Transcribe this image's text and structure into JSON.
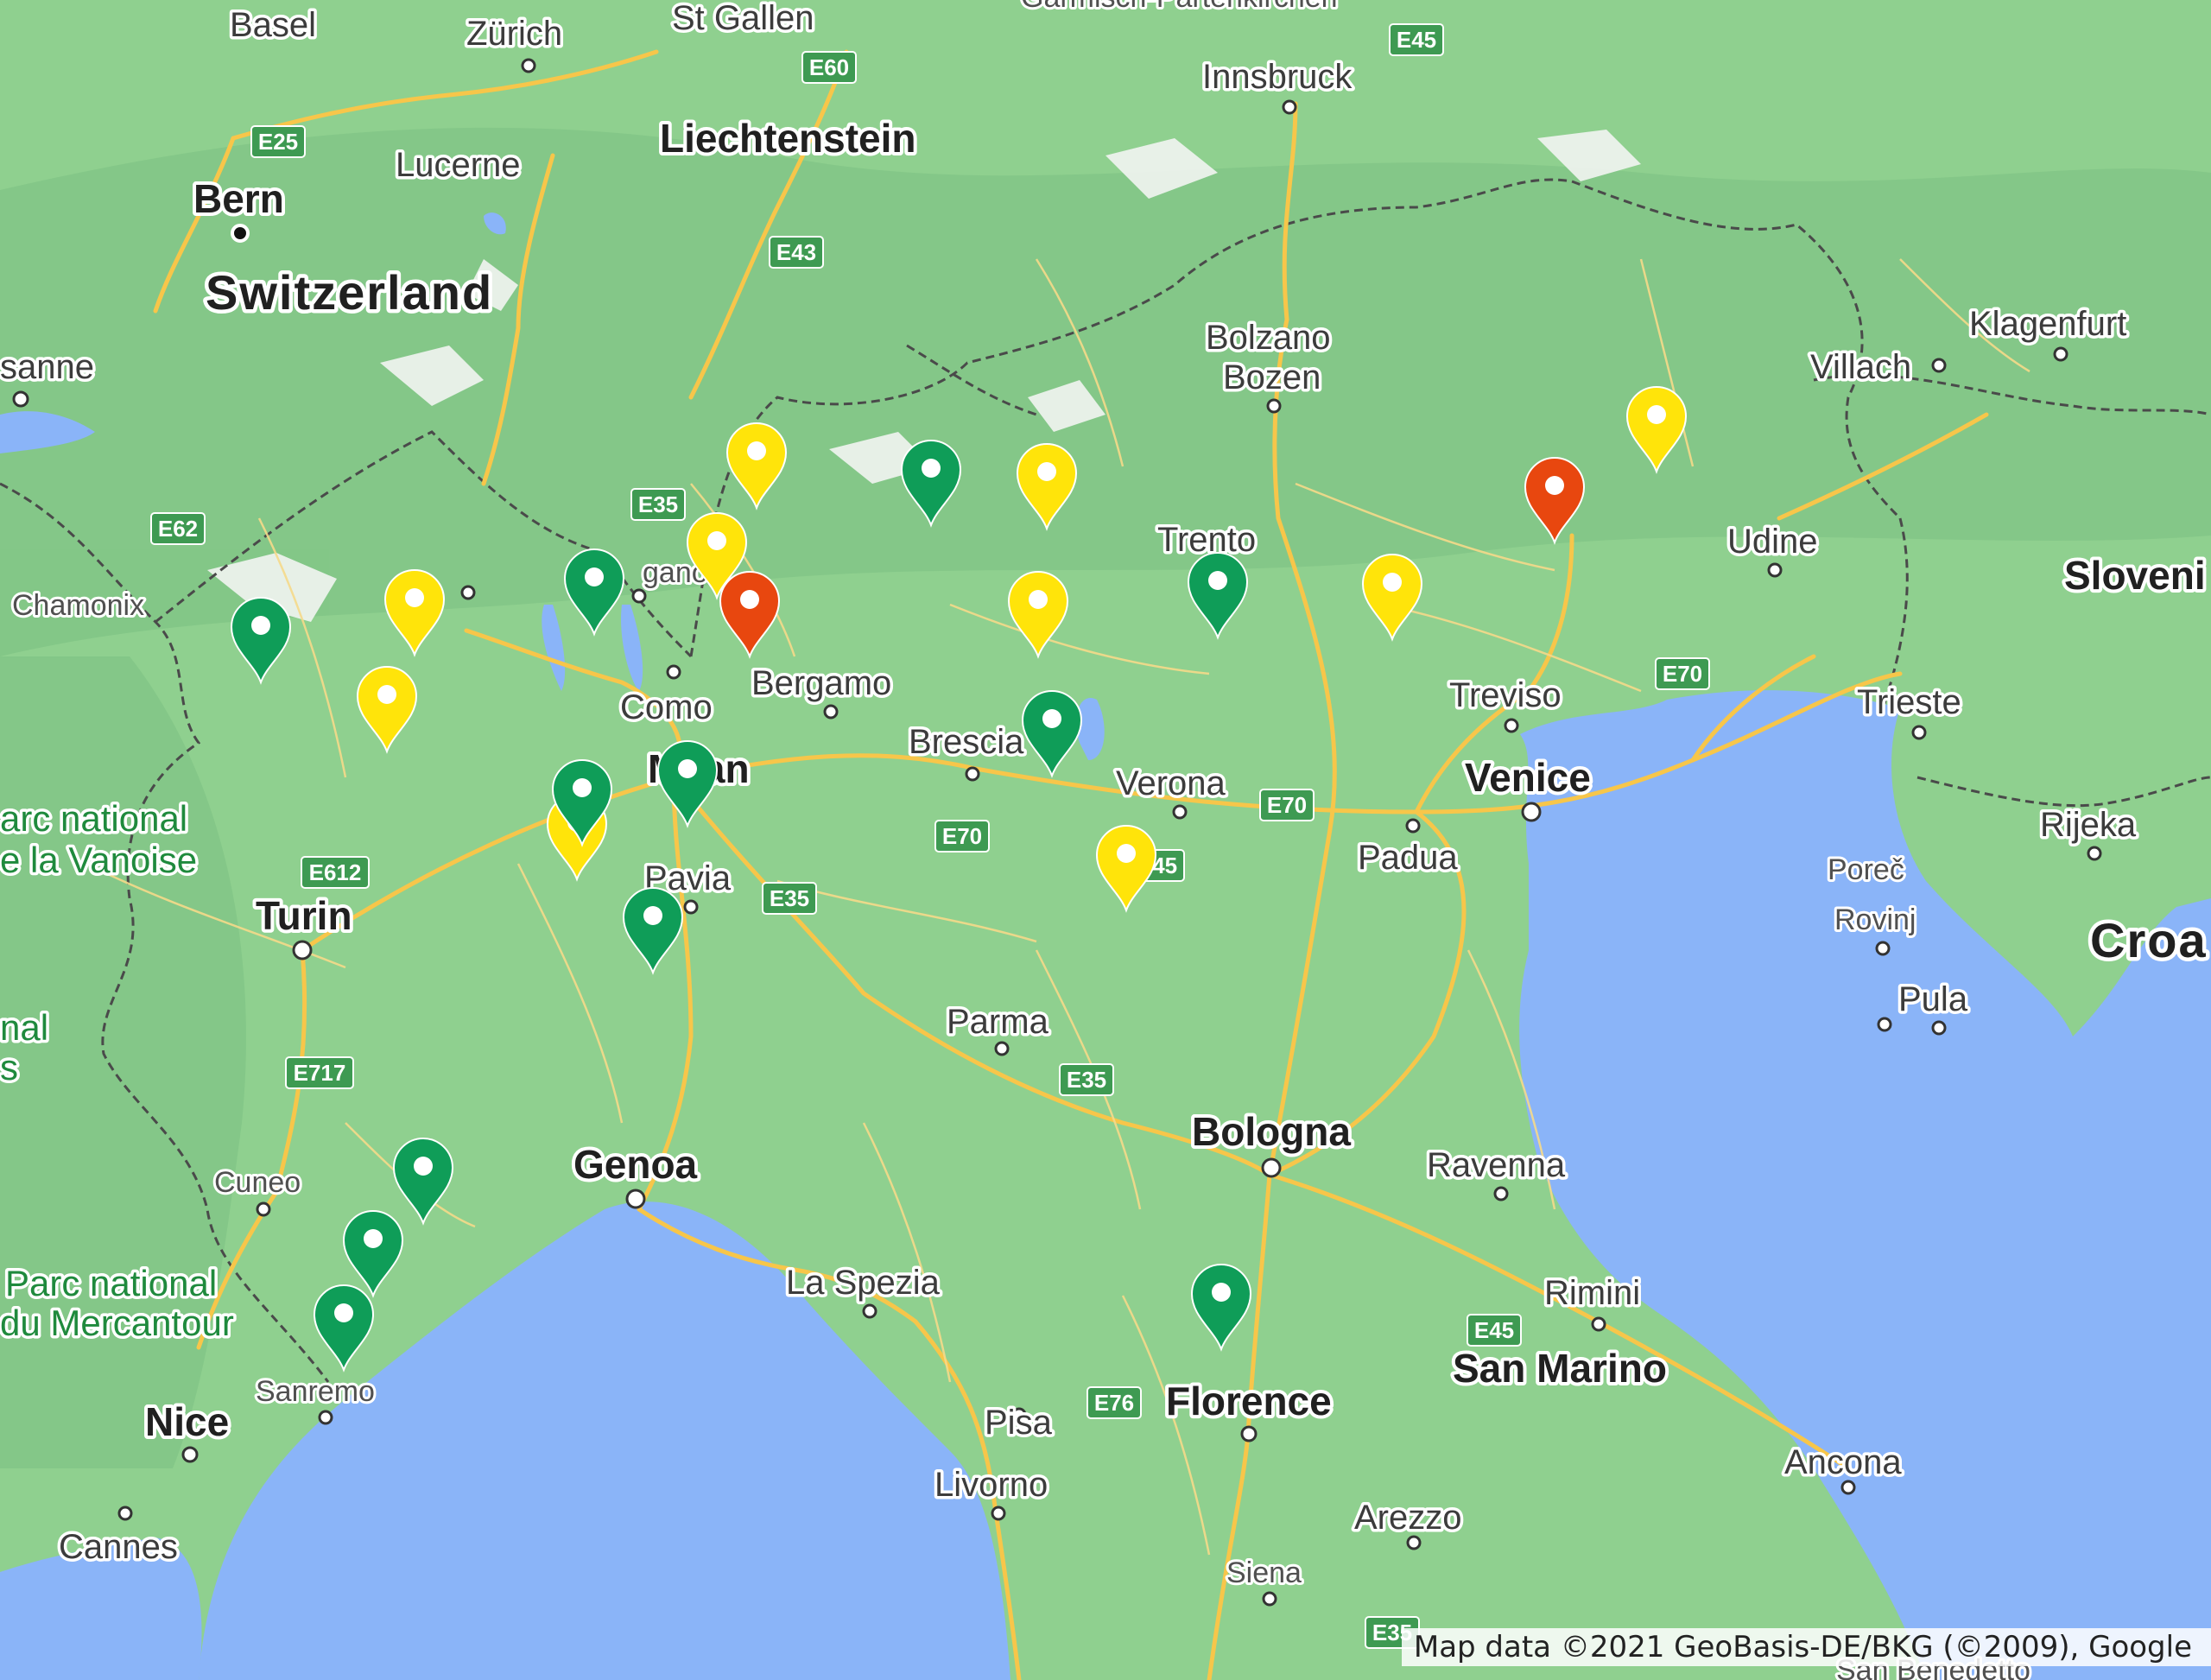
{
  "map": {
    "colors": {
      "land": "#8fd08f",
      "water": "#8ab4f8",
      "road": "#f7c64a",
      "border": "#4a4a4a"
    },
    "countries": [
      {
        "id": "switzerland",
        "name": "Switzerland"
      },
      {
        "id": "liechtenstein",
        "name": "Liechtenstein"
      },
      {
        "id": "slovenia",
        "name": "Sloveni"
      },
      {
        "id": "croatia",
        "name": "Croa"
      },
      {
        "id": "san-marino",
        "name": "San Marino"
      }
    ],
    "cities": [
      {
        "id": "basel",
        "name": "Basel"
      },
      {
        "id": "zurich",
        "name": "Zürich"
      },
      {
        "id": "st-gallen",
        "name": "St Gallen"
      },
      {
        "id": "garmisch",
        "name": "Garmisch-Partenkirchen"
      },
      {
        "id": "innsbruck",
        "name": "Innsbruck"
      },
      {
        "id": "lucerne",
        "name": "Lucerne"
      },
      {
        "id": "bern",
        "name": "Bern"
      },
      {
        "id": "lausanne",
        "name": "sanne"
      },
      {
        "id": "chamonix",
        "name": "Chamonix"
      },
      {
        "id": "lugano",
        "name": "gano"
      },
      {
        "id": "como",
        "name": "Como"
      },
      {
        "id": "bergamo",
        "name": "Bergamo"
      },
      {
        "id": "brescia",
        "name": "Brescia"
      },
      {
        "id": "milan",
        "name": "Milan"
      },
      {
        "id": "pavia",
        "name": "Pavia"
      },
      {
        "id": "turin",
        "name": "Turin"
      },
      {
        "id": "verona",
        "name": "Verona"
      },
      {
        "id": "trento",
        "name": "Trento"
      },
      {
        "id": "bolzano",
        "name": "Bolzano"
      },
      {
        "id": "bozen",
        "name": "Bozen"
      },
      {
        "id": "treviso",
        "name": "Treviso"
      },
      {
        "id": "venice",
        "name": "Venice"
      },
      {
        "id": "padua",
        "name": "Padua"
      },
      {
        "id": "udine",
        "name": "Udine"
      },
      {
        "id": "villach",
        "name": "Villach"
      },
      {
        "id": "klagenfurt",
        "name": "Klagenfurt"
      },
      {
        "id": "trieste",
        "name": "Trieste"
      },
      {
        "id": "rijeka",
        "name": "Rijeka"
      },
      {
        "id": "porec",
        "name": "Poreč"
      },
      {
        "id": "rovinj",
        "name": "Rovinj"
      },
      {
        "id": "pula",
        "name": "Pula"
      },
      {
        "id": "parma",
        "name": "Parma"
      },
      {
        "id": "bologna",
        "name": "Bologna"
      },
      {
        "id": "ravenna",
        "name": "Ravenna"
      },
      {
        "id": "rimini",
        "name": "Rimini"
      },
      {
        "id": "genoa",
        "name": "Genoa"
      },
      {
        "id": "cuneo",
        "name": "Cuneo"
      },
      {
        "id": "la-spezia",
        "name": "La Spezia"
      },
      {
        "id": "sanremo",
        "name": "Sanremo"
      },
      {
        "id": "nice",
        "name": "Nice"
      },
      {
        "id": "cannes",
        "name": "Cannes"
      },
      {
        "id": "pisa",
        "name": "Pisa"
      },
      {
        "id": "livorno",
        "name": "Livorno"
      },
      {
        "id": "florence",
        "name": "Florence"
      },
      {
        "id": "arezzo",
        "name": "Arezzo"
      },
      {
        "id": "siena",
        "name": "Siena"
      },
      {
        "id": "ancona",
        "name": "Ancona"
      },
      {
        "id": "san-benedetto",
        "name": "San Benedetto"
      }
    ],
    "parks": [
      {
        "id": "vanoise-1",
        "name": "arc national"
      },
      {
        "id": "vanoise-2",
        "name": "e la Vanoise"
      },
      {
        "id": "mercantour-1",
        "name": "Parc national"
      },
      {
        "id": "mercantour-2",
        "name": "du Mercantour"
      },
      {
        "id": "ecrins-1",
        "name": "nal"
      },
      {
        "id": "ecrins-2",
        "name": "s"
      }
    ],
    "highways": [
      {
        "id": "e45-north",
        "name": "E45"
      },
      {
        "id": "e60",
        "name": "E60"
      },
      {
        "id": "e25",
        "name": "E25"
      },
      {
        "id": "e43",
        "name": "E43"
      },
      {
        "id": "e35-north",
        "name": "E35"
      },
      {
        "id": "e62",
        "name": "E62"
      },
      {
        "id": "e612",
        "name": "E612"
      },
      {
        "id": "e35-pavia",
        "name": "E35"
      },
      {
        "id": "e70-brescia",
        "name": "E70"
      },
      {
        "id": "e45-verona",
        "name": "E45"
      },
      {
        "id": "e70-verona",
        "name": "E70"
      },
      {
        "id": "e70-venice",
        "name": "E70"
      },
      {
        "id": "e717",
        "name": "E717"
      },
      {
        "id": "e35-bologna",
        "name": "E35"
      },
      {
        "id": "e45-rimini",
        "name": "E45"
      },
      {
        "id": "e76",
        "name": "E76"
      },
      {
        "id": "e35-south",
        "name": "E35"
      }
    ],
    "markers": [
      {
        "id": "marker-1",
        "color": "yellow"
      },
      {
        "id": "marker-2",
        "color": "green"
      },
      {
        "id": "marker-3",
        "color": "yellow"
      },
      {
        "id": "marker-4",
        "color": "yellow"
      },
      {
        "id": "marker-5",
        "color": "red"
      },
      {
        "id": "marker-6",
        "color": "yellow"
      },
      {
        "id": "marker-7",
        "color": "green"
      },
      {
        "id": "marker-8",
        "color": "yellow"
      },
      {
        "id": "marker-9",
        "color": "green"
      },
      {
        "id": "marker-10",
        "color": "yellow"
      },
      {
        "id": "marker-11",
        "color": "red"
      },
      {
        "id": "marker-12",
        "color": "yellow"
      },
      {
        "id": "marker-13",
        "color": "green"
      },
      {
        "id": "marker-14",
        "color": "yellow"
      },
      {
        "id": "marker-15",
        "color": "green"
      },
      {
        "id": "marker-16",
        "color": "yellow"
      },
      {
        "id": "marker-17",
        "color": "yellow"
      },
      {
        "id": "marker-18",
        "color": "green"
      },
      {
        "id": "marker-19",
        "color": "green"
      },
      {
        "id": "marker-20",
        "color": "green"
      },
      {
        "id": "marker-21",
        "color": "green"
      },
      {
        "id": "marker-22",
        "color": "green"
      },
      {
        "id": "marker-23",
        "color": "green"
      },
      {
        "id": "marker-24",
        "color": "green"
      }
    ],
    "marker_colors": {
      "green": "#0f9d58",
      "yellow": "#ffe40a",
      "red": "#e8470f"
    }
  },
  "attribution": "Map data ©2021 GeoBasis-DE/BKG (©2009), Google"
}
